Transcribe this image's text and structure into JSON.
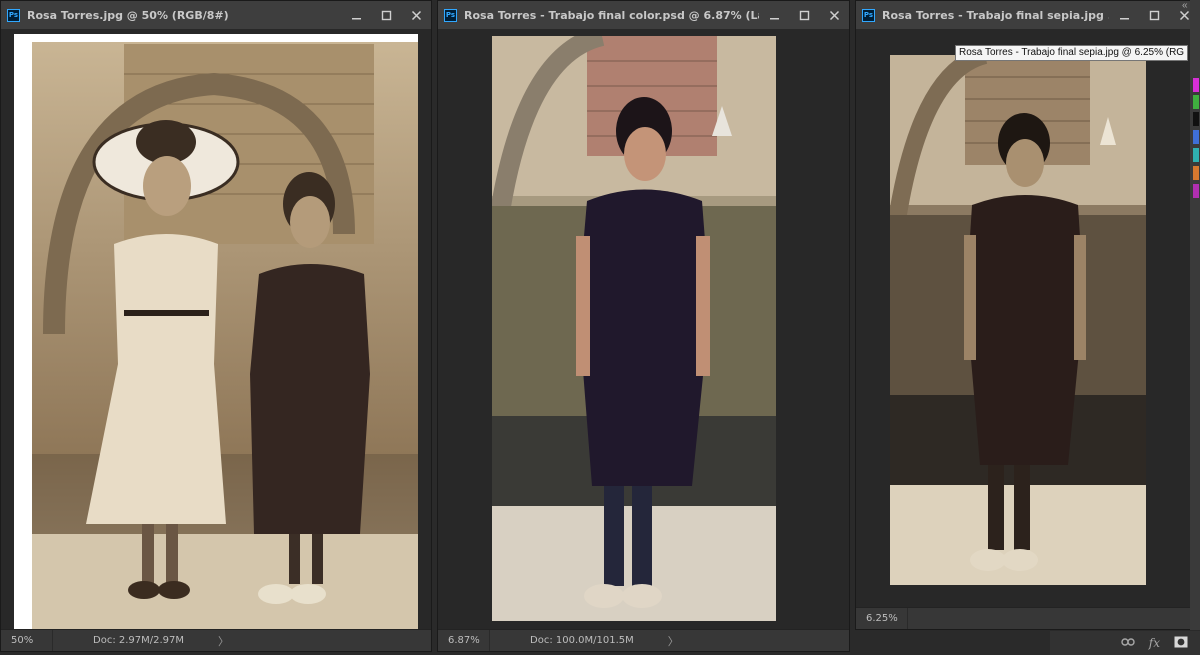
{
  "windows": [
    {
      "title": "Rosa Torres.jpg @ 50% (RGB/8#)",
      "zoom": "50%",
      "doc": "Doc: 2.97M/2.97M"
    },
    {
      "title": "Rosa Torres - Trabajo final color.psd @ 6.87% (La...",
      "zoom": "6.87%",
      "doc": "Doc: 100.0M/101.5M"
    },
    {
      "title": "Rosa Torres - Trabajo final sepia.jpg ...",
      "zoom": "6.25%",
      "doc": ""
    }
  ],
  "ps_badge": "Ps",
  "tooltip": "Rosa Torres - Trabajo final sepia.jpg @ 6.25% (RG",
  "panel_collapse": "«",
  "bottom_icons": [
    "link-icon",
    "fx-icon",
    "mask-icon"
  ],
  "fx_label": "fx",
  "status_arrow": "〉",
  "colors": {
    "sepia_bg": "#b49c78",
    "dress_dark": "#2a1d1a",
    "color_dress": "#20182c",
    "accent": "#31a8ff"
  }
}
